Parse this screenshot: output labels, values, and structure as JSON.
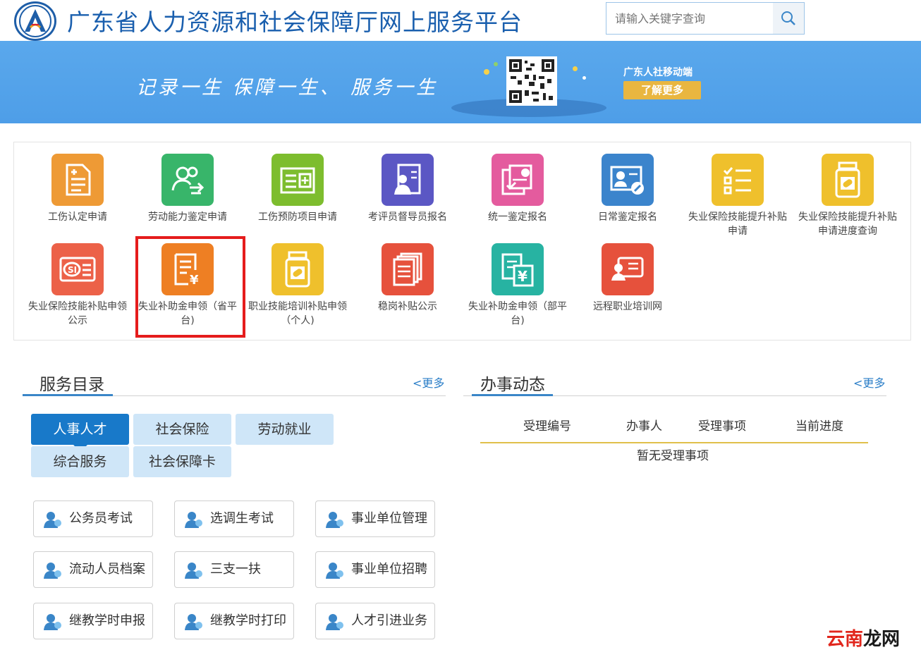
{
  "header": {
    "title": "广东省人力资源和社会保障厅网上服务平台",
    "search_placeholder": "请输入关键字查询"
  },
  "banner": {
    "slogan": "记录一生  保障一生、 服务一生",
    "mobile_title": "广东人社移动端",
    "learn_more": "了解更多"
  },
  "services": [
    {
      "label": "工伤认定申请",
      "color": "#ee9a35",
      "icon": "document-icon"
    },
    {
      "label": "劳动能力鉴定申请",
      "color": "#38b56a",
      "icon": "users-exchange-icon"
    },
    {
      "label": "工伤预防项目申请",
      "color": "#7dbd2e",
      "icon": "medical-kit-icon"
    },
    {
      "label": "考评员督导员报名",
      "color": "#5b57c4",
      "icon": "person-id-icon"
    },
    {
      "label": "统一鉴定报名",
      "color": "#e45b9e",
      "icon": "payment-form-icon"
    },
    {
      "label": "日常鉴定报名",
      "color": "#3b84cc",
      "icon": "id-card-edit-icon"
    },
    {
      "label": "失业保险技能提升补贴申请",
      "color": "#efc02c",
      "icon": "checklist-icon"
    },
    {
      "label": "失业保险技能提升补贴申请进度查询",
      "color": "#efc02c",
      "icon": "pill-bottle-icon"
    },
    {
      "label": "失业保险技能补贴申领公示",
      "color": "#ec6148",
      "icon": "si-card-icon"
    },
    {
      "label": "失业补助金申领（省平台)",
      "color": "#ee7f23",
      "icon": "yuan-document-icon"
    },
    {
      "label": "职业技能培训补贴申领（个人)",
      "color": "#efc02c",
      "icon": "pill-bottle-icon"
    },
    {
      "label": "稳岗补贴公示",
      "color": "#e6513c",
      "icon": "stacked-docs-icon"
    },
    {
      "label": "失业补助金申领（部平台)",
      "color": "#27b3a2",
      "icon": "yuan-docs-icon"
    },
    {
      "label": "远程职业培训网",
      "color": "#e6513c",
      "icon": "person-card-icon"
    }
  ],
  "catalog": {
    "title": "服务目录",
    "more": "<更多",
    "tabs": [
      "人事人才",
      "社会保险",
      "劳动就业",
      "综合服务",
      "社会保障卡"
    ],
    "active_tab": "人事人才",
    "items": [
      "公务员考试",
      "选调生考试",
      "事业单位管理",
      "流动人员档案",
      "三支一扶",
      "事业单位招聘",
      "继教学时申报",
      "继教学时打印",
      "人才引进业务"
    ]
  },
  "activity": {
    "title": "办事动态",
    "more": "<更多",
    "columns": [
      "受理编号",
      "办事人",
      "受理事项",
      "当前进度"
    ],
    "empty": "暂无受理事项"
  },
  "watermark": {
    "part1": "云南",
    "part2": "龙网"
  }
}
